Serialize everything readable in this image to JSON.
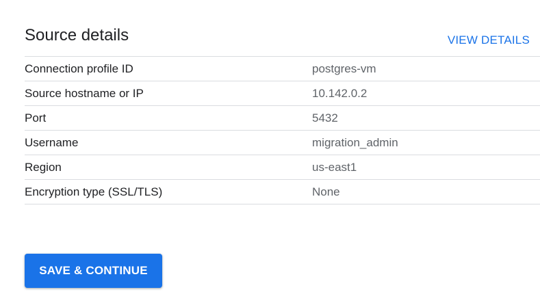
{
  "section": {
    "title": "Source details",
    "view_details_label": "VIEW DETAILS"
  },
  "details": {
    "rows": [
      {
        "label": "Connection profile ID",
        "value": "postgres-vm"
      },
      {
        "label": "Source hostname or IP",
        "value": "10.142.0.2"
      },
      {
        "label": "Port",
        "value": "5432"
      },
      {
        "label": "Username",
        "value": "migration_admin"
      },
      {
        "label": "Region",
        "value": "us-east1"
      },
      {
        "label": "Encryption type (SSL/TLS)",
        "value": "None"
      }
    ]
  },
  "actions": {
    "save_continue_label": "SAVE & CONTINUE"
  },
  "colors": {
    "accent": "#1a73e8",
    "divider": "#dadce0",
    "value_text": "#5f6368",
    "label_text": "#202124"
  }
}
